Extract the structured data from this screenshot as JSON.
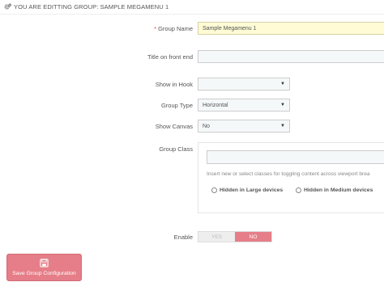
{
  "header": {
    "title": "YOU ARE EDITTING GROUP: SAMPLE MEGAMENU 1"
  },
  "fields": {
    "group_name": {
      "required_mark": "*",
      "label": "Group Name",
      "value": "Sample Megamenu 1"
    },
    "title_front": {
      "label": "Title on front end",
      "value": ""
    },
    "show_in_hook": {
      "label": "Show in Hook",
      "value": ""
    },
    "group_type": {
      "label": "Group Type",
      "value": "Horizontal"
    },
    "show_canvas": {
      "label": "Show Canvas",
      "value": "No"
    },
    "group_class": {
      "label": "Group Class",
      "value": "",
      "help": "Insert new or select classes for toggling content across viewport brea",
      "options": [
        {
          "label": "Hidden in Large devices",
          "checked": false
        },
        {
          "label": "Hidden in Medium devices",
          "checked": false
        }
      ]
    },
    "enable": {
      "label": "Enable",
      "yes": "YES",
      "no": "NO",
      "selected": "NO"
    }
  },
  "actions": {
    "save_label": "Save Group Configuration"
  },
  "colors": {
    "save_button": "#e57e88",
    "required": "#e74c3c",
    "name_field_bg": "#fefbd5"
  },
  "icons": {
    "header": "cogs-icon",
    "save": "floppy-disk-icon",
    "select": "caret-down-icon"
  }
}
